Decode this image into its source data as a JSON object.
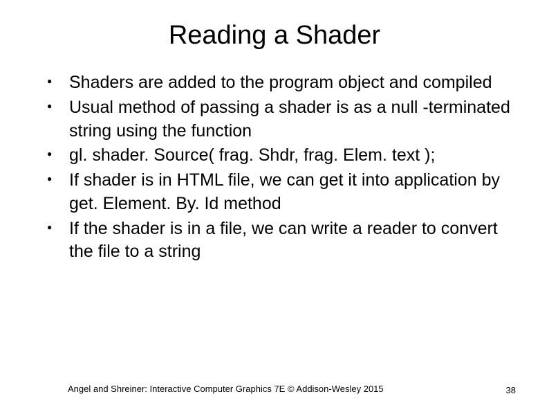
{
  "title": "Reading a Shader",
  "bullets": [
    "Shaders are added to the program object and compiled",
    "Usual method of passing a shader is as a null -terminated string using the function",
    " gl. shader. Source( frag. Shdr, frag. Elem. text );",
    "If shader is in HTML file, we can get it into application by get. Element. By. Id method",
    "If the shader is in a file, we can write a reader to convert the file to a string"
  ],
  "footer": "Angel and Shreiner: Interactive Computer Graphics 7E © Addison-Wesley 2015",
  "page_number": "38"
}
